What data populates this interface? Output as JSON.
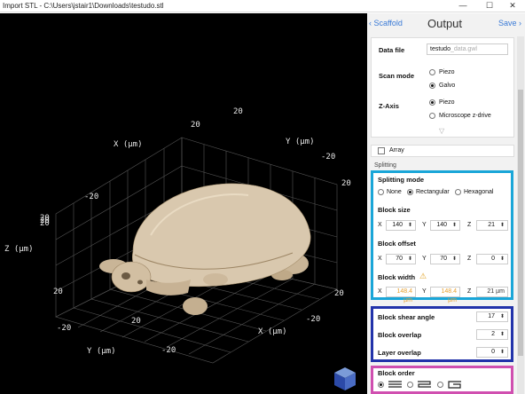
{
  "window": {
    "title": "Import STL - C:\\Users\\jstair1\\Downloads\\testudo.stl",
    "min_glyph": "—",
    "max_glyph": "☐",
    "close_glyph": "✕"
  },
  "viewport": {
    "axis_labels": {
      "x_top": "X (µm)",
      "y_top": "Y (µm)",
      "z_left": "Z (µm)",
      "x_bottom": "X (µm)",
      "y_bottom": "Y (µm)"
    },
    "ticks": {
      "top_20a": "20",
      "top_20b": "20",
      "top_right_20": "20",
      "left_neg20": "-20",
      "right_neg20": "-20",
      "left_z_a": "20",
      "left_z_b": "20",
      "left_z_c": "20",
      "bottom_left_20": "20",
      "bottom_mid_20": "20",
      "bottom_right_20": "20",
      "bottom_neg20a": "-20",
      "bottom_neg20b": "-20",
      "bottom_neg20c": "-20"
    },
    "model_color": "#d8c7ad"
  },
  "panel": {
    "back_label": "Scaffold",
    "title": "Output",
    "forward_label": "Save",
    "data_file": {
      "label": "Data file",
      "value_prefix": "testudo",
      "value_suffix": "_data.gwl"
    },
    "scan_mode": {
      "label": "Scan mode",
      "options": [
        "Piezo",
        "Galvo"
      ],
      "selected": "Galvo"
    },
    "z_axis": {
      "label": "Z-Axis",
      "options": [
        "Piezo",
        "Microscope z-drive"
      ],
      "selected": "Piezo"
    },
    "array_label": "Array",
    "splitting_header": "Splitting",
    "splitting_mode": {
      "label": "Splitting mode",
      "options": [
        "None",
        "Rectangular",
        "Hexagonal"
      ],
      "selected": "Rectangular"
    },
    "block_size": {
      "label": "Block size",
      "x": "140",
      "y": "140",
      "z": "21"
    },
    "block_offset": {
      "label": "Block offset",
      "x": "70",
      "y": "70",
      "z": "0"
    },
    "block_width": {
      "label": "Block width",
      "x": "148.4 µm",
      "y": "148.4 µm",
      "z": "21 µm"
    },
    "block_shear_angle": {
      "label": "Block shear angle",
      "value": "17"
    },
    "block_overlap": {
      "label": "Block overlap",
      "value": "2"
    },
    "layer_overlap": {
      "label": "Layer overlap",
      "value": "0"
    },
    "block_order": {
      "label": "Block order"
    },
    "axis_letters": {
      "x": "X",
      "y": "Y",
      "z": "Z"
    },
    "spin_glyph": "⬍",
    "warning_glyph": "⚠"
  },
  "highlight_colors": {
    "cyan": "#1aa6d8",
    "blue": "#2233aa",
    "magenta": "#d04fb0"
  }
}
